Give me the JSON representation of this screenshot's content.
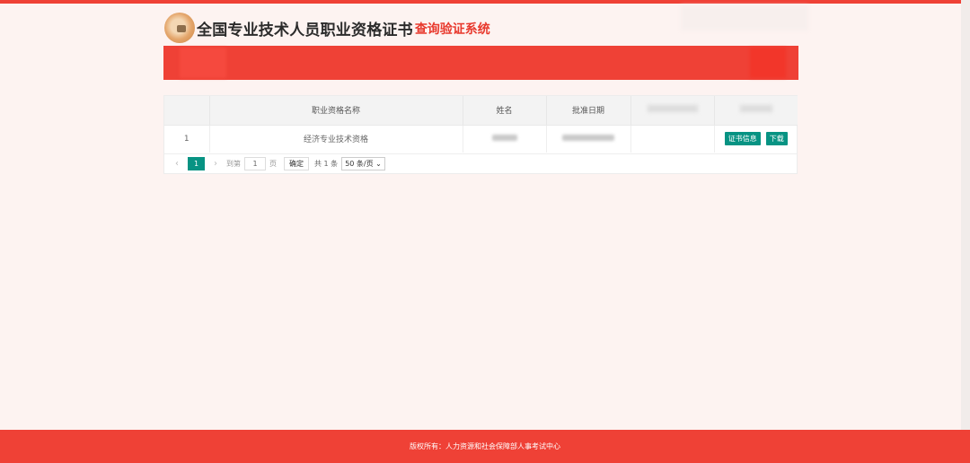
{
  "header": {
    "title_main": "全国专业技术人员职业资格证书",
    "title_sub": "查询验证系统"
  },
  "table": {
    "columns": [
      "职业资格名称",
      "姓名",
      "批准日期"
    ],
    "rows": [
      {
        "index": "1",
        "qualification": "经济专业技术资格"
      }
    ],
    "actions": {
      "certificate_info": "证书信息",
      "download": "下载"
    }
  },
  "pagination": {
    "current_page": "1",
    "goto_label": "到第",
    "page_input": "1",
    "page_unit": "页",
    "confirm": "确定",
    "total": "共 1 条",
    "page_size": "50 条/页"
  },
  "footer": {
    "copyright": "版权所有：人力资源和社会保障部人事考试中心"
  },
  "colors": {
    "brand_red": "#ef4136",
    "accent_teal": "#079383",
    "background": "#fdf3f1"
  }
}
